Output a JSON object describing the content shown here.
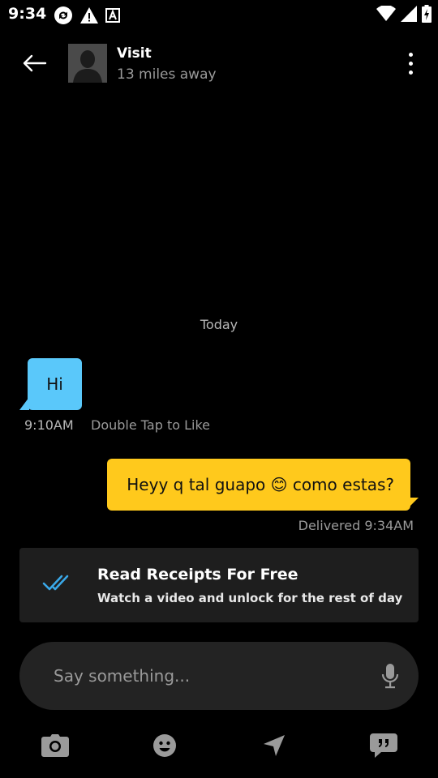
{
  "status_bar": {
    "time": "9:34",
    "left_icons": [
      "sync-icon",
      "warning-icon",
      "font-icon"
    ],
    "right_icons": [
      "wifi-icon",
      "signal-icon",
      "battery-icon"
    ]
  },
  "header": {
    "back_icon": "arrow-left-icon",
    "name": "Visit",
    "distance": "13 miles away",
    "menu_icon": "more-vert-icon"
  },
  "chat": {
    "day_label": "Today",
    "messages": [
      {
        "direction": "incoming",
        "text": "Hi",
        "time": "9:10AM",
        "hint": "Double Tap to Like",
        "bubble_color": "#5ac8fa"
      },
      {
        "direction": "outgoing",
        "text": "Heyy q tal guapo 😊 como estas?",
        "status": "Delivered 9:34AM",
        "bubble_color": "#ffc91c"
      }
    ]
  },
  "read_receipts": {
    "icon": "double-check-icon",
    "title": "Read Receipts For Free",
    "subtitle": "Watch a video and unlock for the rest of day",
    "accent_color": "#3aa8e8"
  },
  "composer": {
    "placeholder": "Say something...",
    "mic_icon": "mic-icon"
  },
  "toolbar": {
    "items": [
      "camera-icon",
      "emoji-icon",
      "location-icon",
      "quick-reply-icon"
    ]
  }
}
